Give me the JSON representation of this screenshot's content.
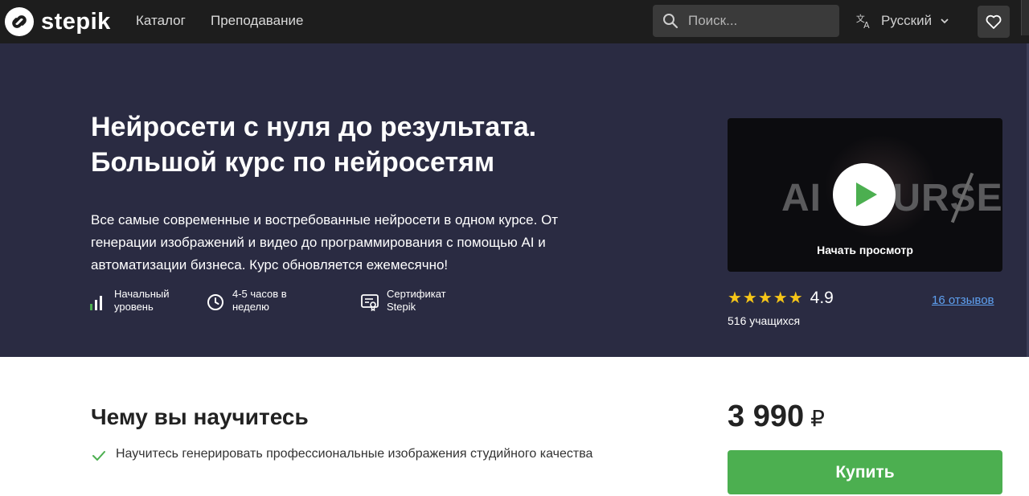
{
  "header": {
    "logo_text": "stepik",
    "nav": [
      "Каталог",
      "Преподавание"
    ],
    "search_placeholder": "Поиск...",
    "language": "Русский"
  },
  "course": {
    "title_line1": "Нейросети с нуля до результата.",
    "title_line2": "Большой курс по нейросетям",
    "description": "Все самые современные и востребованные нейросети в одном курсе. От генерации изображений и видео до программирования с помощью AI и автоматизации бизнеса. Курс обновляется ежемесячно!",
    "features": [
      {
        "line1": "Начальный",
        "line2": "уровень",
        "icon": "level-bars-icon"
      },
      {
        "line1": "4-5 часов в",
        "line2": "неделю",
        "icon": "clock-icon"
      },
      {
        "line1": "Сертификат",
        "line2": "Stepik",
        "icon": "certificate-icon"
      }
    ]
  },
  "video": {
    "overlay_text": "AI COURSE",
    "caption": "Начать просмотр"
  },
  "rating": {
    "stars": "★★★★★",
    "value": "4.9",
    "reviews_link": "16 отзывов",
    "learners": "516 учащихся"
  },
  "learn": {
    "title": "Чему вы научитесь",
    "items": [
      "Научитесь генерировать профессиональные изображения студийного качества"
    ]
  },
  "purchase": {
    "price": "3 990",
    "currency": "₽",
    "buy_label": "Купить"
  },
  "colors": {
    "topbar": "#1d1d1d",
    "hero": "#2a2b42",
    "accent_green": "#4caf50",
    "link_blue": "#5ea0f0",
    "star": "#f5c518"
  }
}
